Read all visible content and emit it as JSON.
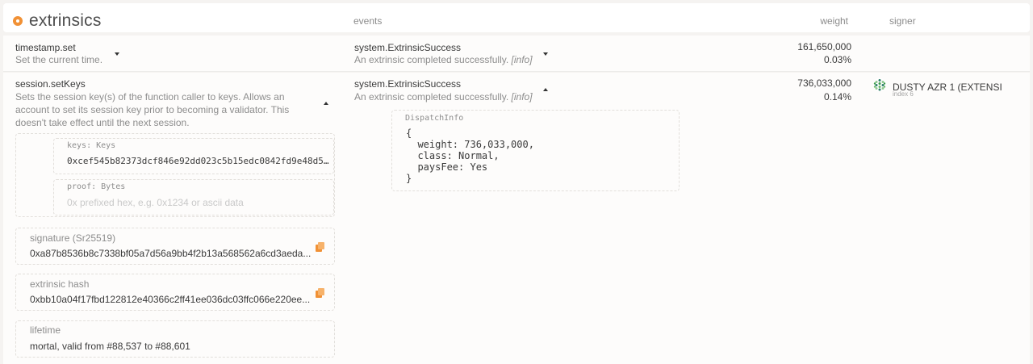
{
  "header": {
    "title": "extrinsics",
    "col_events": "events",
    "col_weight": "weight",
    "col_signer": "signer"
  },
  "rows": [
    {
      "call": "timestamp.set",
      "call_desc": "Set the current time.",
      "event": "system.ExtrinsicSuccess",
      "event_desc": "An extrinsic completed successfully.",
      "event_info": "[info]",
      "weight": "161,650,000",
      "weight_pct": "0.03%"
    },
    {
      "call": "session.setKeys",
      "call_desc_lines": [
        "Sets the session key(s) of the function caller to keys. Allows an",
        "account to set its session key prior to becoming a validator. This",
        "doesn't take effect until the next session."
      ],
      "params": [
        {
          "label": "keys: Keys",
          "value": "0xcef545b82373dcf846e92dd023c5b15edc0842fd9e48d5 ..."
        },
        {
          "label": "proof: Bytes",
          "placeholder": "0x prefixed hex, e.g. 0x1234 or ascii data"
        }
      ],
      "signature_label": "signature (Sr25519)",
      "signature_value": "0xa87b8536b8c7338bf05a7d56a9bb4f2b13a568562a6cd3aeda...",
      "hash_label": "extrinsic hash",
      "hash_value": "0xbb10a04f17fbd122812e40366c2ff41ee036dc03ffc066e220ee...",
      "lifetime_label": "lifetime",
      "lifetime_value": "mortal, valid from #88,537 to #88,601",
      "event": "system.ExtrinsicSuccess",
      "event_desc": "An extrinsic completed successfully.",
      "event_info": "[info]",
      "dispatch_label": "DispatchInfo",
      "dispatch_json": "{\n  weight: 736,033,000,\n  class: Normal,\n  paysFee: Yes\n}",
      "weight": "736,033,000",
      "weight_pct": "0.14%",
      "signer_name": "DUSTY AZR 1 (EXTENSI",
      "signer_index": "index 6"
    }
  ],
  "colors": {
    "accent": "#f19135",
    "background": "#f5f3f1",
    "panel": "#fdfcfb",
    "text": "#3a3a3a",
    "muted": "#8d8d8d"
  },
  "icons": {
    "header": "circle-dot-icon",
    "toggle_collapsed": "caret-down-icon",
    "toggle_expanded": "caret-up-icon",
    "copy": "copy-icon",
    "signer": "identicon"
  }
}
